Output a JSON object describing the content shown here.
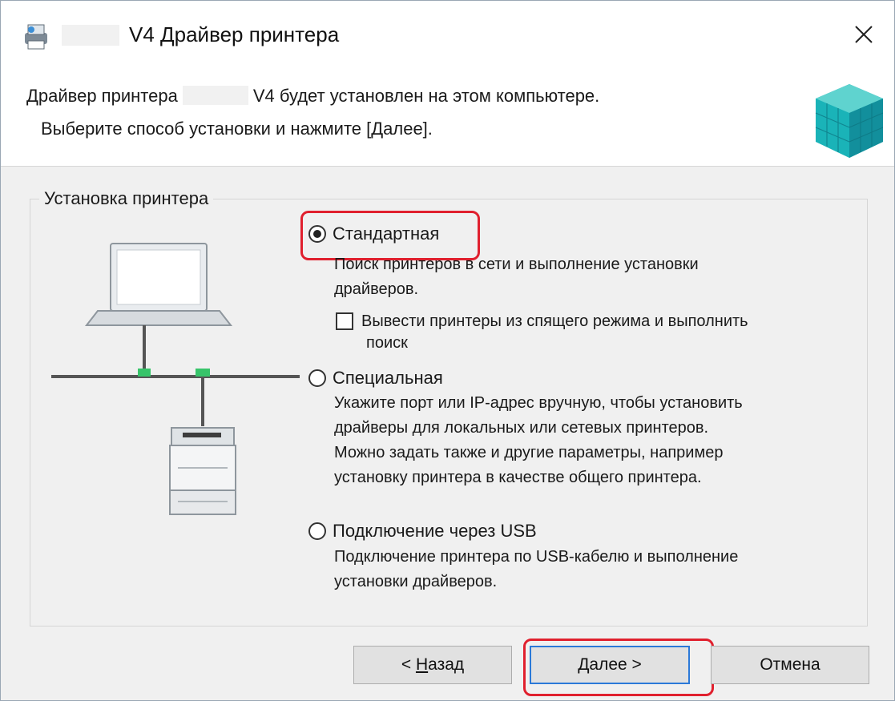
{
  "window": {
    "title": "V4 Драйвер принтера"
  },
  "header": {
    "line1_before": "Драйвер принтера",
    "line1_after": "V4 будет установлен на этом компьютере.",
    "line2": "Выберите способ установки и нажмите [Далее]."
  },
  "group": {
    "title": "Установка принтера",
    "options": [
      {
        "label": "Стандартная",
        "selected": true,
        "desc": [
          "Поиск принтеров в сети и выполнение установки",
          "драйверов."
        ]
      },
      {
        "label": "Специальная",
        "selected": false,
        "desc": [
          "Укажите порт или IP-адрес вручную, чтобы установить",
          "драйверы для локальных или сетевых принтеров.",
          "Можно задать также и другие параметры, например",
          "установку принтера в качестве общего принтера."
        ]
      },
      {
        "label": "Подключение через USB",
        "selected": false,
        "desc": [
          "Подключение принтера по USB-кабелю и выполнение",
          "установки драйверов."
        ]
      }
    ],
    "wake_checkbox": {
      "label_line1": "Вывести принтеры из спящего режима и выполнить",
      "label_line2": "поиск",
      "checked": false
    }
  },
  "buttons": {
    "back_accel": "Н",
    "back_rest": "азад",
    "back_prefix": "< ",
    "next_accel": "Д",
    "next_rest": "алее >",
    "cancel": "Отмена"
  },
  "colors": {
    "highlight": "#e0202e",
    "network_accent": "#37c46a",
    "brand_cube": "#1ab3b8"
  }
}
